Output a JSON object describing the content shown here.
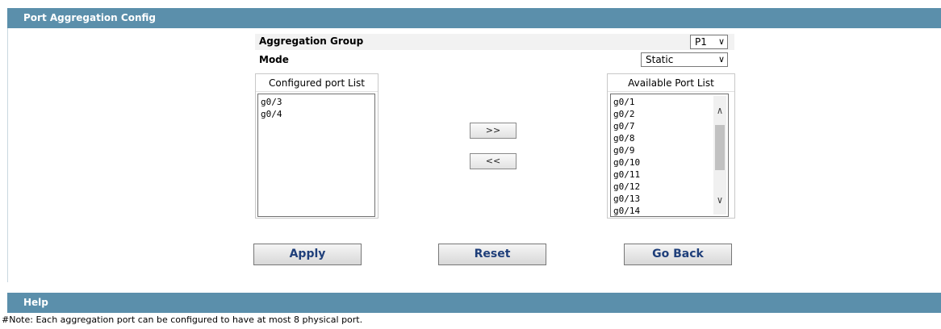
{
  "config_header": {
    "title": "Port Aggregation Config"
  },
  "aggregation_group": {
    "label": "Aggregation Group",
    "value": "P1"
  },
  "mode": {
    "label": "Mode",
    "value": "Static"
  },
  "configured_list": {
    "title": "Configured port List",
    "items": [
      "g0/3",
      "g0/4"
    ]
  },
  "available_list": {
    "title": "Available Port List",
    "items": [
      "g0/1",
      "g0/2",
      "g0/7",
      "g0/8",
      "g0/9",
      "g0/10",
      "g0/11",
      "g0/12",
      "g0/13",
      "g0/14"
    ]
  },
  "move_buttons": {
    "add": ">>",
    "remove": "<<"
  },
  "actions": {
    "apply": "Apply",
    "reset": "Reset",
    "go_back": "Go Back"
  },
  "help_header": {
    "title": "Help"
  },
  "note": "#Note: Each aggregation port can be configured to have at most 8 physical port.",
  "icons": {
    "dropdown": "chevron-down-icon",
    "scroll_up": "chevron-up-icon",
    "scroll_down": "chevron-down-icon"
  },
  "colors": {
    "header_bg": "#5b8fab",
    "button_text": "#1f3f7a"
  }
}
